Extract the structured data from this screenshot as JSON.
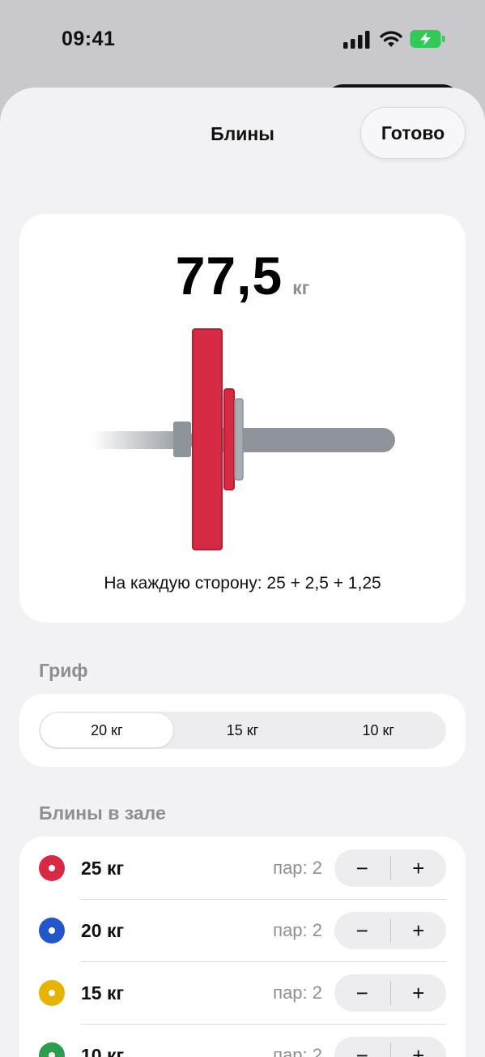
{
  "status_bar": {
    "time": "09:41"
  },
  "nav": {
    "title": "Блины",
    "done_label": "Готово"
  },
  "summary": {
    "total_value": "77,5",
    "total_unit": "кг",
    "per_side_text": "На каждую сторону: 25 + 2,5 + 1,25"
  },
  "bar_section": {
    "label": "Гриф",
    "options": [
      {
        "label": "20 кг",
        "selected": true
      },
      {
        "label": "15 кг",
        "selected": false
      },
      {
        "label": "10 кг",
        "selected": false
      }
    ]
  },
  "plates_section": {
    "label": "Блины в зале",
    "plates": [
      {
        "label": "25 кг",
        "pairs": "пар: 2",
        "color": "#d62a44"
      },
      {
        "label": "20 кг",
        "pairs": "пар: 2",
        "color": "#2357c9"
      },
      {
        "label": "15 кг",
        "pairs": "пар: 2",
        "color": "#e6b400"
      },
      {
        "label": "10 кг",
        "pairs": "пар: 2",
        "color": "#2e9c4f"
      }
    ],
    "minus_symbol": "−",
    "plus_symbol": "+"
  },
  "colors": {
    "accent_red": "#d62a44",
    "bar_gray": "#8e9499",
    "battery_green": "#34c759"
  }
}
